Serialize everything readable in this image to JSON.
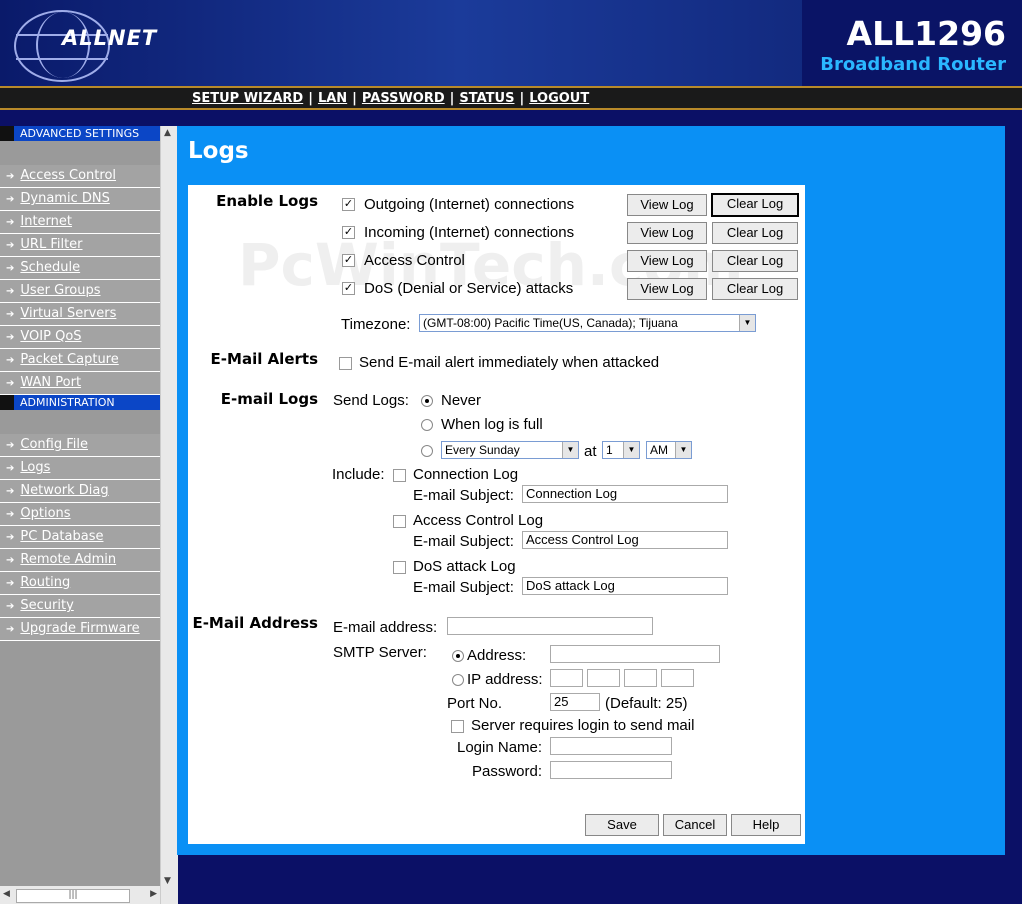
{
  "header": {
    "brand": "ALLNET",
    "model": "ALL1296",
    "subtitle": "Broadband Router"
  },
  "nav": {
    "setup_wizard": "SETUP WIZARD",
    "lan": "LAN",
    "password": "PASSWORD",
    "status": "STATUS",
    "logout": "LOGOUT",
    "separator": "|"
  },
  "sidebar": {
    "advanced_heading": "ADVANCED SETTINGS",
    "advanced_items": [
      "Access Control",
      "Dynamic DNS",
      "Internet",
      "URL Filter",
      "Schedule",
      "User Groups",
      "Virtual Servers",
      "VOIP QoS",
      "Packet Capture",
      "WAN Port"
    ],
    "admin_heading": "ADMINISTRATION",
    "admin_items": [
      "Config File",
      "Logs",
      "Network Diag",
      "Options",
      "PC Database",
      "Remote Admin",
      "Routing",
      "Security",
      "Upgrade Firmware"
    ]
  },
  "page": {
    "title": "Logs",
    "watermark": "PcWinTech.com"
  },
  "enable_logs": {
    "label": "Enable Logs",
    "rows": [
      {
        "text": "Outgoing (Internet) connections",
        "checked": true
      },
      {
        "text": "Incoming (Internet) connections",
        "checked": true
      },
      {
        "text": "Access Control",
        "checked": true
      },
      {
        "text": "DoS (Denial or Service) attacks",
        "checked": true
      }
    ],
    "view_label": "View Log",
    "clear_label": "Clear Log",
    "timezone_label": "Timezone:",
    "timezone_value": "(GMT-08:00) Pacific Time(US, Canada); Tijuana"
  },
  "email_alerts": {
    "label": "E-Mail Alerts",
    "option": "Send E-mail alert immediately when attacked",
    "checked": false
  },
  "email_logs": {
    "label": "E-mail Logs",
    "send_label": "Send Logs:",
    "never": "Never",
    "when_full": "When log is full",
    "day_value": "Every Sunday",
    "at_label": "at",
    "hour_value": "1",
    "ampm_value": "AM",
    "include_label": "Include:",
    "subject_label": "E-mail Subject:",
    "items": [
      {
        "name": "Connection Log",
        "subject": "Connection Log",
        "checked": false
      },
      {
        "name": "Access Control Log",
        "subject": "Access Control Log",
        "checked": false
      },
      {
        "name": "DoS attack Log",
        "subject": "DoS attack Log",
        "checked": false
      }
    ]
  },
  "email_address": {
    "label": "E-Mail Address",
    "address_label": "E-mail address:",
    "smtp_label": "SMTP Server:",
    "address_opt": "Address:",
    "ip_opt": "IP address:",
    "port_label": "Port No.",
    "port_value": "25",
    "port_default": "(Default: 25)",
    "login_required": "Server requires login to send mail",
    "login_name_label": "Login Name:",
    "password_label": "Password:"
  },
  "buttons": {
    "save": "Save",
    "cancel": "Cancel",
    "help": "Help"
  },
  "colors": {
    "content_bg": "#0a90f5",
    "nav_bg": "#1a1a1a",
    "section_heading": "#0b46c6",
    "subtitle": "#2ab7ff"
  }
}
